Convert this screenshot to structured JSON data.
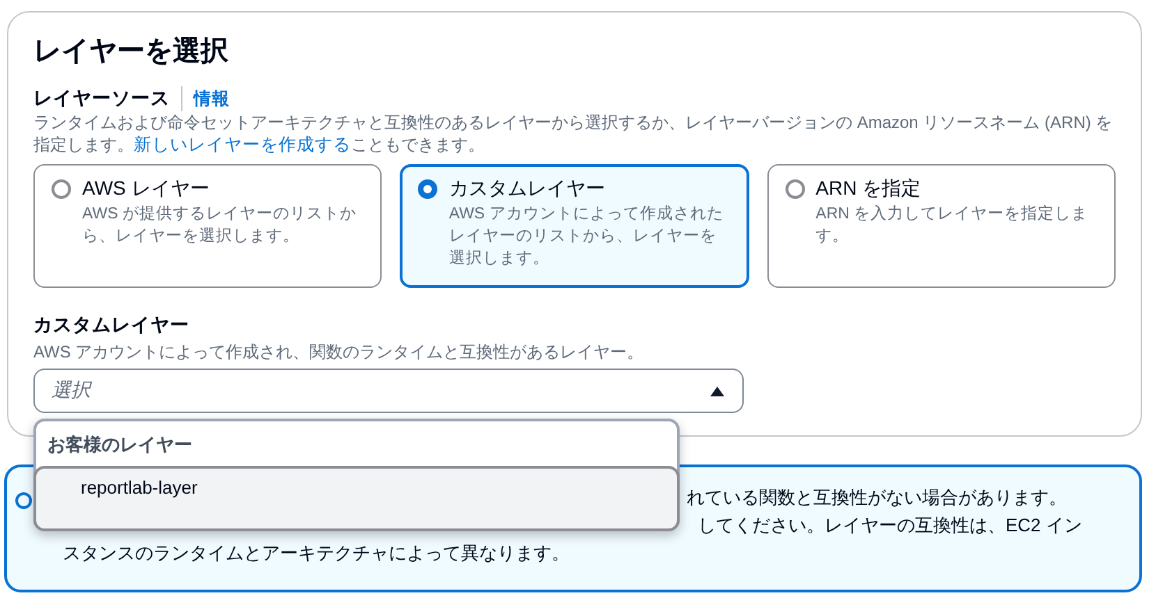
{
  "section": {
    "title": "レイヤーを選択"
  },
  "layer_source": {
    "label": "レイヤーソース",
    "info_link": "情報",
    "description_before": "ランタイムおよび命令セットアーキテクチャと互換性のあるレイヤーから選択するか、レイヤーバージョンの Amazon リソースネーム (ARN) を指定します。",
    "description_link": "新しいレイヤーを作成する",
    "description_after": "こともできます。",
    "options": [
      {
        "title": "AWS レイヤー",
        "description": "AWS が提供するレイヤーのリストから、レイヤーを選択します。",
        "selected": false
      },
      {
        "title": "カスタムレイヤー",
        "description": "AWS アカウントによって作成されたレイヤーのリストから、レイヤーを選択します。",
        "selected": true
      },
      {
        "title": "ARN を指定",
        "description": "ARN を入力してレイヤーを指定します。",
        "selected": false
      }
    ]
  },
  "custom_layer": {
    "label": "カスタムレイヤー",
    "description": "AWS アカウントによって作成され、関数のランタイムと互換性があるレイヤー。",
    "select": {
      "placeholder": "選択",
      "expanded": true
    },
    "dropdown": {
      "group": "お客様のレイヤー",
      "options": [
        {
          "label": "reportlab-layer",
          "highlighted": true
        }
      ]
    }
  },
  "alert": {
    "lines": [
      "れている関数と互換性がない場合があります。",
      "してください。レイヤーの互換性は、EC2 イン",
      "スタンスのランタイムとアーキテクチャによって異なります。"
    ]
  }
}
